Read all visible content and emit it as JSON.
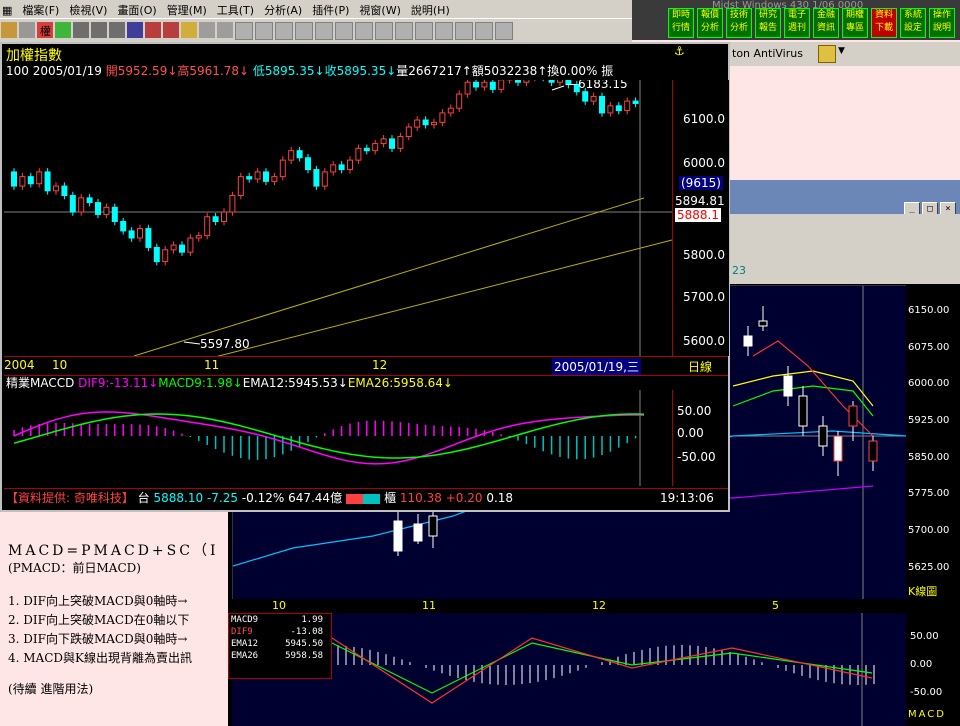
{
  "menu": [
    "檔案(F)",
    "檢視(V)",
    "畫面(O)",
    "管理(M)",
    "工具(T)",
    "分析(A)",
    "插件(P)",
    "視窗(W)",
    "說明(H)"
  ],
  "toolbar_right_label": "權",
  "quick_buttons": [
    "即時\n行情",
    "報價\n分析",
    "技術\n分析",
    "研究\n報告",
    "電子\n週刊",
    "金融\n資訊",
    "期權\n專區",
    "資料\n下載",
    "系統\n設定",
    "操作\n說明"
  ],
  "window_title_right": "Midst Windows 430 1/06 0000",
  "antivirus_label": "ton AntiVirus",
  "main": {
    "title": "加權指數",
    "info": [
      {
        "text": "100 2005/01/19",
        "color": "#ffffff"
      },
      {
        "text": " 開5952.59↓",
        "color": "#ff5050"
      },
      {
        "text": "高5961.78↓",
        "color": "#ff5050"
      },
      {
        "text": " 低5895.35↓",
        "color": "#00ffff"
      },
      {
        "text": "收5895.35↓",
        "color": "#00ffff"
      },
      {
        "text": "量2667217↑",
        "color": "#ffffff"
      },
      {
        "text": "額5032238↑",
        "color": "#ffffff"
      },
      {
        "text": "換0.00%",
        "color": "#ffffff"
      },
      {
        "text": " 振",
        "color": "#ffffff"
      }
    ],
    "high_label": "6183.15",
    "low_label": "5597.80",
    "y_ticks": [
      "6100.0",
      "6000.0",
      "5800.0",
      "5700.0",
      "5600.0"
    ],
    "y_count": "(9615)",
    "y_current": "5894.81",
    "y_mark": "5888.1",
    "x_labels": [
      "2004",
      "10",
      "11",
      "12"
    ],
    "x_date": "2005/01/19,三",
    "x_period": "日線",
    "macd_info": [
      {
        "text": "精業MACCD ",
        "color": "#ffffff"
      },
      {
        "text": "DIF9:-13.11↓",
        "color": "#ff00ff"
      },
      {
        "text": "MACD9:1.98↓",
        "color": "#00ff00"
      },
      {
        "text": "EMA12:5945.53↓",
        "color": "#ffffff"
      },
      {
        "text": "EMA26:5958.64↓",
        "color": "#ffff00"
      }
    ],
    "macd_ticks": [
      "50.00",
      "0.00",
      "-50.00"
    ],
    "status": {
      "provider": "【資料提供: 奇唯科技】",
      "index_label": "台",
      "index_value": "5888.10",
      "change": "-7.25",
      "pct": "-0.12%",
      "volume": "647.44億",
      "otc_label": "櫃",
      "otc_value": "110.38",
      "otc_change": "+0.20",
      "otc_extra": "0.18",
      "time": "19:13:06"
    }
  },
  "background_chart": {
    "label_23": "23",
    "y_ticks": [
      "6150.00",
      "6075.00",
      "6000.00",
      "5925.00",
      "5850.00",
      "5775.00",
      "5700.00",
      "5625.00"
    ],
    "period": "K線圖",
    "x_labels": [
      "10",
      "11",
      "12",
      "5"
    ],
    "macd_rows": [
      {
        "name": "MACD9",
        "value": "1.99",
        "color": "#ffffff"
      },
      {
        "name": "DIF9",
        "value": "-13.08",
        "color": "#ff5050"
      },
      {
        "name": "EMA12",
        "value": "5945.50",
        "color": "#ffffff"
      },
      {
        "name": "EMA26",
        "value": "5958.58",
        "color": "#ffffff"
      }
    ],
    "macd_ticks": [
      "50.00",
      "0.00",
      "-50.00"
    ],
    "macd_label": "MACD"
  },
  "notes": {
    "formula": "MACD=PMACD+SC（I",
    "sub": "(PMACD：前日MACD)",
    "items": [
      "1. DIF向上突破MACD與0軸時→",
      "2. DIF向上突破MACD在0軸以下",
      "3. DIF向下跌破MACD與0軸時→",
      "4. MACD與K線出現背離為賣出訊"
    ],
    "footer": "(待續 進階用法)"
  }
}
